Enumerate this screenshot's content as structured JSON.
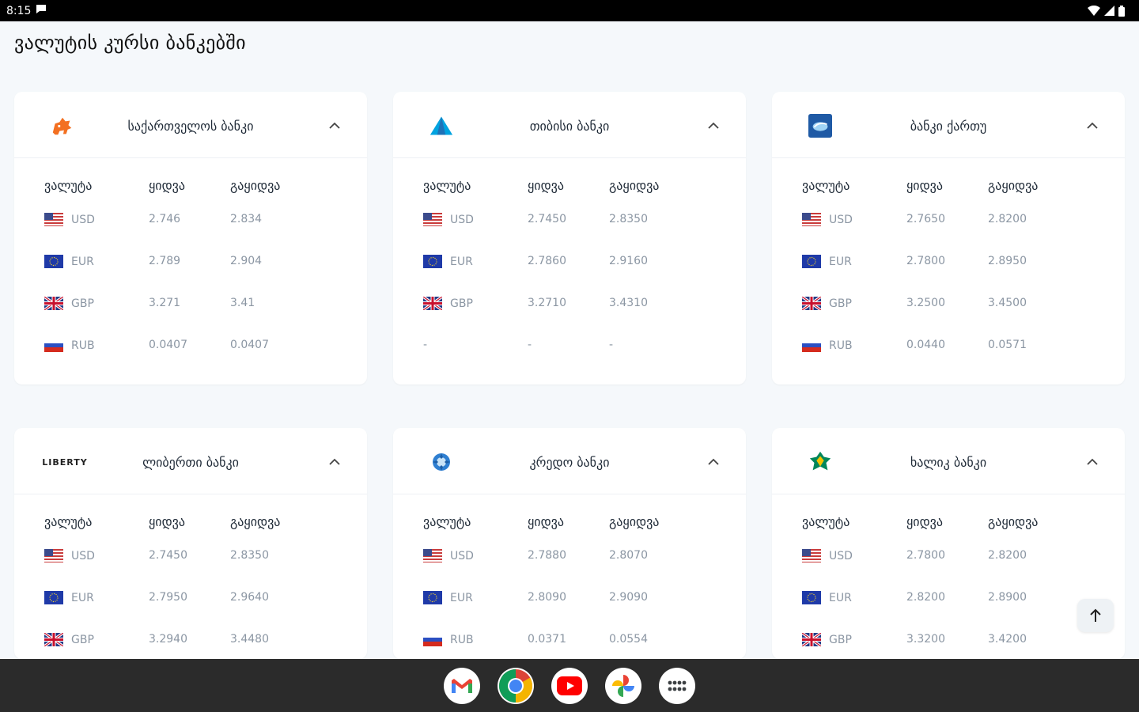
{
  "status": {
    "time": "8:15"
  },
  "page": {
    "title": "ვალუტის კურსი ბანკებში"
  },
  "columns": {
    "currency": "ვალუტა",
    "buy": "ყიდვა",
    "sell": "გაყიდვა"
  },
  "banks": [
    {
      "name": "საქართველოს ბანკი",
      "logo": "bog-horse-logo",
      "rates": [
        {
          "flag": "us",
          "currency": "USD",
          "buy": "2.746",
          "sell": "2.834"
        },
        {
          "flag": "eu",
          "currency": "EUR",
          "buy": "2.789",
          "sell": "2.904"
        },
        {
          "flag": "gb",
          "currency": "GBP",
          "buy": "3.271",
          "sell": "3.41"
        },
        {
          "flag": "ru",
          "currency": "RUB",
          "buy": "0.0407",
          "sell": "0.0407"
        }
      ]
    },
    {
      "name": "თიბისი ბანკი",
      "logo": "tbc-triangle-logo",
      "rates": [
        {
          "flag": "us",
          "currency": "USD",
          "buy": "2.7450",
          "sell": "2.8350"
        },
        {
          "flag": "eu",
          "currency": "EUR",
          "buy": "2.7860",
          "sell": "2.9160"
        },
        {
          "flag": "gb",
          "currency": "GBP",
          "buy": "3.2710",
          "sell": "3.4310"
        },
        {
          "flag": "",
          "currency": "-",
          "buy": "-",
          "sell": "-"
        }
      ]
    },
    {
      "name": "ბანკი ქართუ",
      "logo": "cartu-logo",
      "rates": [
        {
          "flag": "us",
          "currency": "USD",
          "buy": "2.7650",
          "sell": "2.8200"
        },
        {
          "flag": "eu",
          "currency": "EUR",
          "buy": "2.7800",
          "sell": "2.8950"
        },
        {
          "flag": "gb",
          "currency": "GBP",
          "buy": "3.2500",
          "sell": "3.4500"
        },
        {
          "flag": "ru",
          "currency": "RUB",
          "buy": "0.0440",
          "sell": "0.0571"
        }
      ]
    },
    {
      "name": "ლიბერთი ბანკი",
      "logo": "liberty-logo",
      "logo_text": "LIBERTY",
      "rates": [
        {
          "flag": "us",
          "currency": "USD",
          "buy": "2.7450",
          "sell": "2.8350"
        },
        {
          "flag": "eu",
          "currency": "EUR",
          "buy": "2.7950",
          "sell": "2.9640"
        },
        {
          "flag": "gb",
          "currency": "GBP",
          "buy": "3.2940",
          "sell": "3.4480"
        }
      ]
    },
    {
      "name": "კრედო ბანკი",
      "logo": "credo-logo",
      "rates": [
        {
          "flag": "us",
          "currency": "USD",
          "buy": "2.7880",
          "sell": "2.8070"
        },
        {
          "flag": "eu",
          "currency": "EUR",
          "buy": "2.8090",
          "sell": "2.9090"
        },
        {
          "flag": "ru",
          "currency": "RUB",
          "buy": "0.0371",
          "sell": "0.0554"
        }
      ]
    },
    {
      "name": "ხალიკ ბანკი",
      "logo": "halyk-logo",
      "rates": [
        {
          "flag": "us",
          "currency": "USD",
          "buy": "2.7800",
          "sell": "2.8200"
        },
        {
          "flag": "eu",
          "currency": "EUR",
          "buy": "2.8200",
          "sell": "2.8900"
        },
        {
          "flag": "gb",
          "currency": "GBP",
          "buy": "3.3200",
          "sell": "3.4200"
        }
      ]
    }
  ],
  "dock": [
    "gmail-icon",
    "chrome-icon",
    "youtube-icon",
    "photos-icon",
    "app-drawer-icon"
  ]
}
